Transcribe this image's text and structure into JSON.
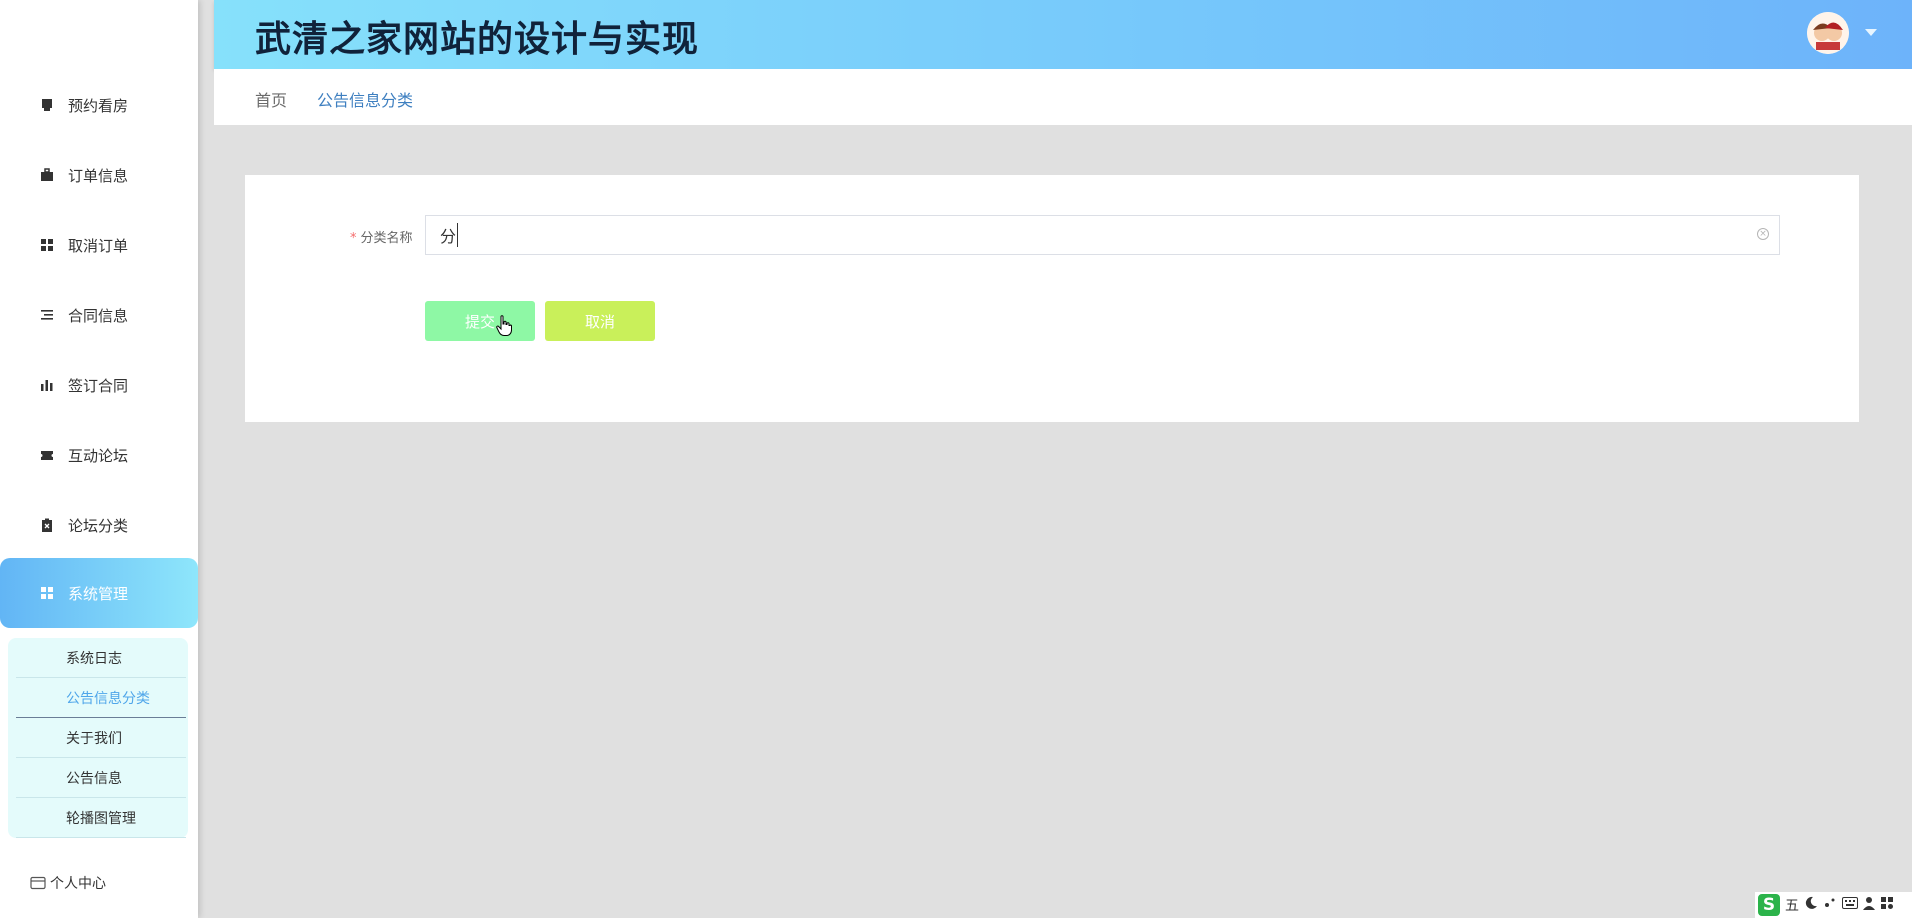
{
  "header": {
    "title": "武清之家网站的设计与实现"
  },
  "breadcrumb": {
    "home": "首页",
    "current": "公告信息分类"
  },
  "sidebar": {
    "items": [
      {
        "label": "预约看房",
        "icon": "printer-icon"
      },
      {
        "label": "订单信息",
        "icon": "briefcase-icon"
      },
      {
        "label": "取消订单",
        "icon": "grid-icon"
      },
      {
        "label": "合同信息",
        "icon": "list-icon"
      },
      {
        "label": "签订合同",
        "icon": "bar-chart-icon"
      },
      {
        "label": "互动论坛",
        "icon": "ticket-icon"
      },
      {
        "label": "论坛分类",
        "icon": "clipboard-x-icon"
      },
      {
        "label": "系统管理",
        "icon": "grid-icon",
        "active": true
      }
    ],
    "submenu": [
      {
        "label": "系统日志"
      },
      {
        "label": "公告信息分类",
        "current": true
      },
      {
        "label": "关于我们"
      },
      {
        "label": "公告信息"
      },
      {
        "label": "轮播图管理"
      }
    ],
    "personal": {
      "label": "个人中心",
      "icon": "card-icon"
    }
  },
  "form": {
    "field_label": "分类名称",
    "required_mark": "*",
    "field_value": "分",
    "submit_label": "提交",
    "cancel_label": "取消"
  },
  "ime": {
    "mode": "五"
  },
  "colors": {
    "header_start": "#86e1fb",
    "header_end": "#6db3fa",
    "active_menu": "#62b5f5",
    "submit": "#8ef8a5",
    "cancel": "#c9f05a",
    "link": "#3e7fc0"
  }
}
